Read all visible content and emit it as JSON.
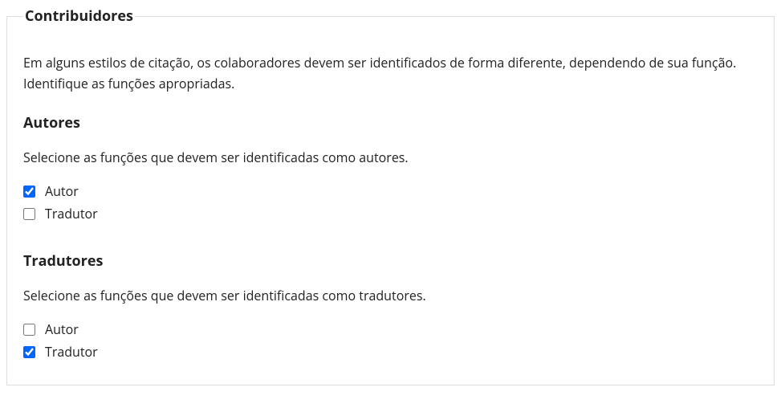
{
  "fieldset": {
    "legend": "Contribuidores",
    "intro": "Em alguns estilos de citação, os colaboradores devem ser identificados de forma diferente, dependendo de sua função. Identifique as funções apropriadas.",
    "sections": {
      "authors": {
        "title": "Autores",
        "desc": "Selecione as funções que devem ser identificadas como autores.",
        "options": {
          "autor": {
            "label": "Autor",
            "checked": "checked"
          },
          "tradutor": {
            "label": "Tradutor"
          }
        }
      },
      "translators": {
        "title": "Tradutores",
        "desc": "Selecione as funções que devem ser identificadas como tradutores.",
        "options": {
          "autor": {
            "label": "Autor"
          },
          "tradutor": {
            "label": "Tradutor",
            "checked": "checked"
          }
        }
      }
    }
  }
}
